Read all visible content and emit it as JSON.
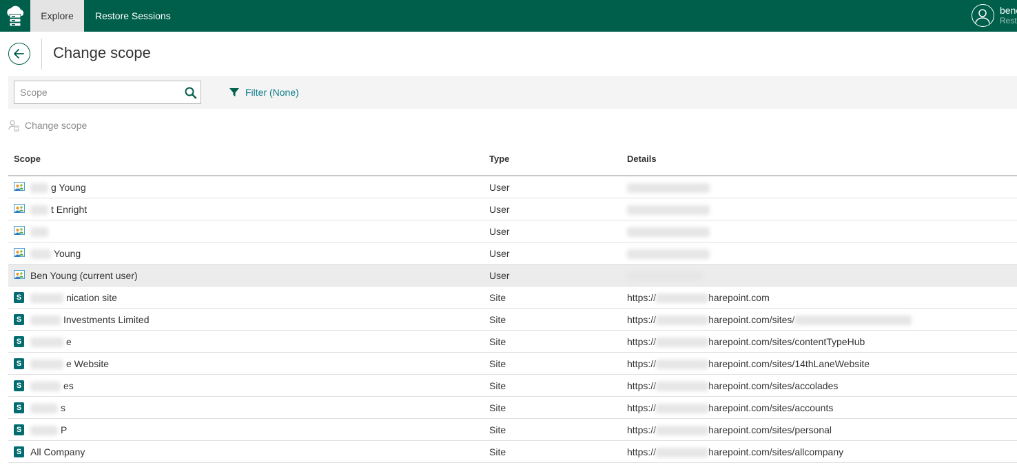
{
  "topbar": {
    "logo_icon": "cloud-server-icon",
    "tabs": [
      {
        "label": "Explore",
        "active": true
      },
      {
        "label": "Restore Sessions",
        "active": false
      }
    ],
    "user": {
      "avatar_icon": "user-avatar-icon",
      "name_visible": "benc",
      "role_visible": "Rest"
    }
  },
  "header": {
    "back_icon": "arrow-left-icon",
    "title": "Change scope"
  },
  "toolbar": {
    "search_placeholder": "Scope",
    "search_value": "",
    "search_icon": "search-icon",
    "filter_icon": "funnel-icon",
    "filter_label": "Filter (None)"
  },
  "actions": {
    "change_scope_icon": "user-scope-icon",
    "change_scope_label": "Change scope",
    "change_scope_enabled": false
  },
  "table": {
    "columns": {
      "scope": "Scope",
      "type": "Type",
      "details": "Details"
    },
    "rows": [
      {
        "icon": "user-icon",
        "scope": "g Young",
        "type": "User",
        "details": ""
      },
      {
        "icon": "user-icon",
        "scope": "t Enright",
        "type": "User",
        "details": ""
      },
      {
        "icon": "user-icon",
        "scope": "",
        "type": "User",
        "details": ""
      },
      {
        "icon": "user-icon",
        "scope": "Young",
        "type": "User",
        "details": ""
      },
      {
        "icon": "user-icon",
        "scope": "Ben Young (current user)",
        "type": "User",
        "details": "",
        "selected": true
      },
      {
        "icon": "sharepoint-icon",
        "scope": "nication site",
        "type": "Site",
        "details_prefix": "https://",
        "details": "harepoint.com"
      },
      {
        "icon": "sharepoint-icon",
        "scope": "Investments Limited",
        "type": "Site",
        "details_prefix": "https://",
        "details": "harepoint.com/sites/"
      },
      {
        "icon": "sharepoint-icon",
        "scope": "e",
        "type": "Site",
        "details_prefix": "https://",
        "details": "harepoint.com/sites/contentTypeHub"
      },
      {
        "icon": "sharepoint-icon",
        "scope": "e Website",
        "type": "Site",
        "details_prefix": "https://",
        "details": "harepoint.com/sites/14thLaneWebsite"
      },
      {
        "icon": "sharepoint-icon",
        "scope": "es",
        "type": "Site",
        "details_prefix": "https://",
        "details": "harepoint.com/sites/accolades"
      },
      {
        "icon": "sharepoint-icon",
        "scope": "s",
        "type": "Site",
        "details_prefix": "https://",
        "details": "harepoint.com/sites/accounts"
      },
      {
        "icon": "sharepoint-icon",
        "scope": "P",
        "type": "Site",
        "details_prefix": "https://",
        "details": "harepoint.com/sites/personal"
      },
      {
        "icon": "sharepoint-icon",
        "scope": "All Company",
        "type": "Site",
        "details_prefix": "https://",
        "details": "harepoint.com/sites/allcompany"
      }
    ]
  },
  "colors": {
    "brand": "#005f4b",
    "link": "#0e7c8a",
    "selected_row": "#ececec",
    "sharepoint": "#036c70"
  }
}
